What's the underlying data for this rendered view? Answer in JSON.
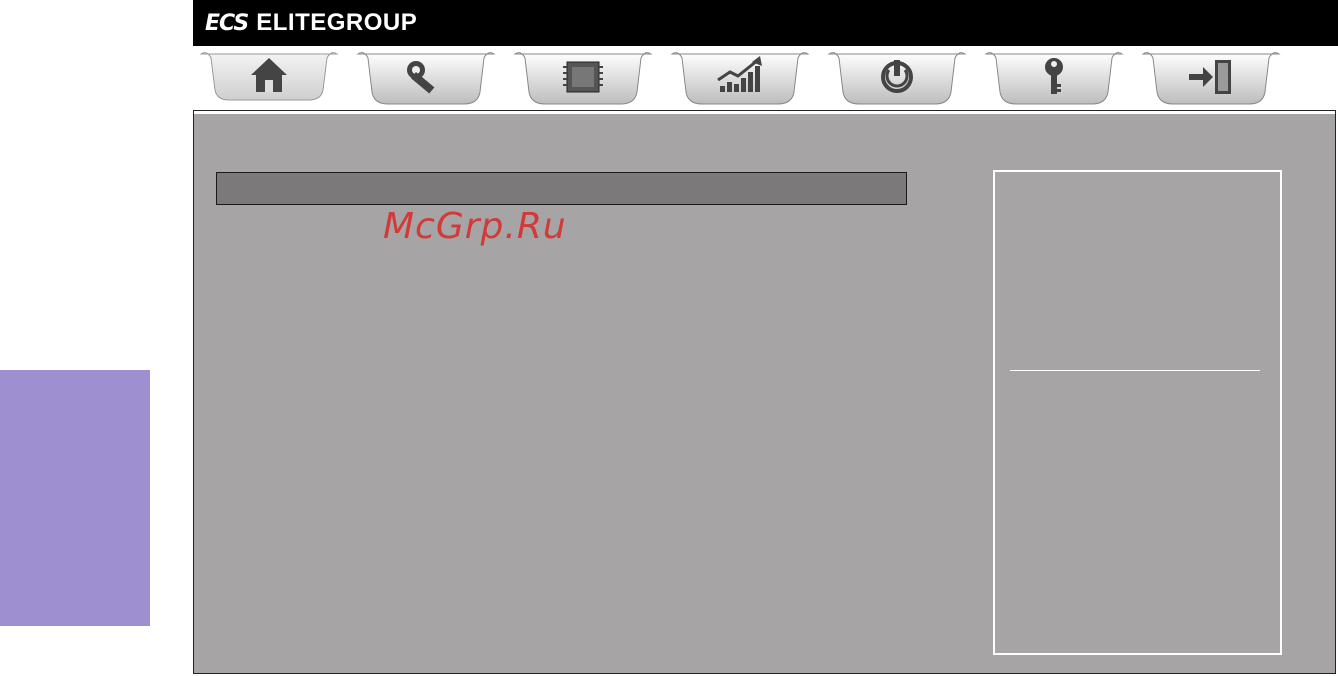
{
  "brand": {
    "mark": "ECS",
    "name": "ELITEGROUP"
  },
  "tabs": [
    {
      "icon": "home-icon",
      "selected": true
    },
    {
      "icon": "wrench-icon",
      "selected": false
    },
    {
      "icon": "chip-icon",
      "selected": false
    },
    {
      "icon": "chart-up-icon",
      "selected": false
    },
    {
      "icon": "power-icon",
      "selected": false
    },
    {
      "icon": "key-icon",
      "selected": false
    },
    {
      "icon": "exit-icon",
      "selected": false
    }
  ],
  "watermark": "McGrp.Ru",
  "colors": {
    "header": "#000000",
    "panel": "#a6a4a5",
    "title_bar": "#7b797a",
    "side_tab": "#9e8fd1",
    "watermark": "#d23a3a"
  }
}
